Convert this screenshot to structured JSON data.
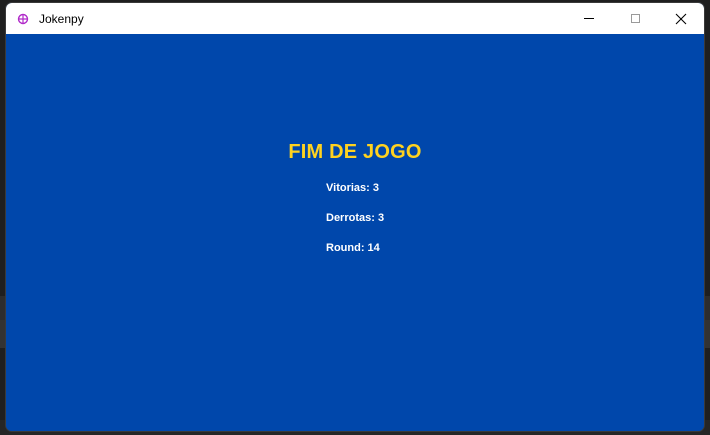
{
  "window": {
    "title": "Jokenpy",
    "app_icon": "pygame-icon"
  },
  "controls": {
    "minimize": "minimize-icon",
    "maximize": "maximize-icon",
    "close": "close-icon"
  },
  "game_over": {
    "heading": "FIM DE JOGO",
    "wins": "Vitorias: 3",
    "losses": "Derrotas: 3",
    "round": "Round: 14"
  },
  "colors": {
    "background": "#0047ab",
    "heading": "#ffd21f",
    "text": "#ffffff"
  }
}
